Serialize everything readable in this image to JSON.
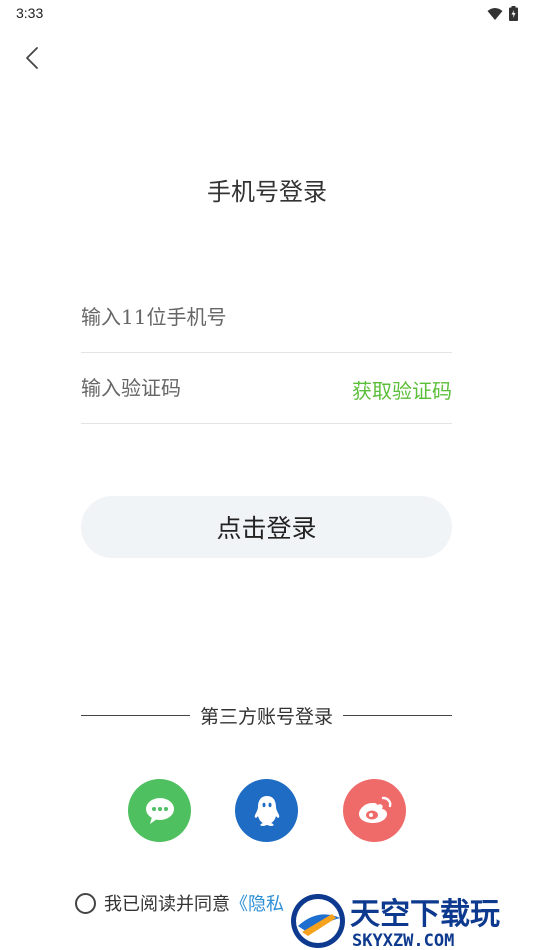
{
  "status_bar": {
    "time": "3:33",
    "icons": [
      "wifi-icon",
      "battery-icon"
    ]
  },
  "header": {
    "back_icon": "chevron-left-icon"
  },
  "title": "手机号登录",
  "phone_field": {
    "placeholder": "输入11位手机号",
    "value": ""
  },
  "code_field": {
    "placeholder": "输入验证码",
    "value": "",
    "get_code_label": "获取验证码"
  },
  "login_button": {
    "label": "点击登录"
  },
  "third_party": {
    "label": "第三方账号登录",
    "providers": [
      {
        "name": "wechat",
        "icon": "wechat-icon",
        "color": "#4ec05f"
      },
      {
        "name": "qq",
        "icon": "qq-icon",
        "color": "#1e6cc4"
      },
      {
        "name": "weibo",
        "icon": "weibo-icon",
        "color": "#ef6b6a"
      }
    ]
  },
  "agreement": {
    "text": "我已阅读并同意",
    "link_text": "《隐私"
  },
  "watermark": {
    "title": "天空下载玩",
    "domain": "SKYXZW.COM"
  },
  "colors": {
    "accent_green": "#5cbf3a",
    "link_blue": "#2f8fd6",
    "button_bg": "#f1f4f7"
  }
}
